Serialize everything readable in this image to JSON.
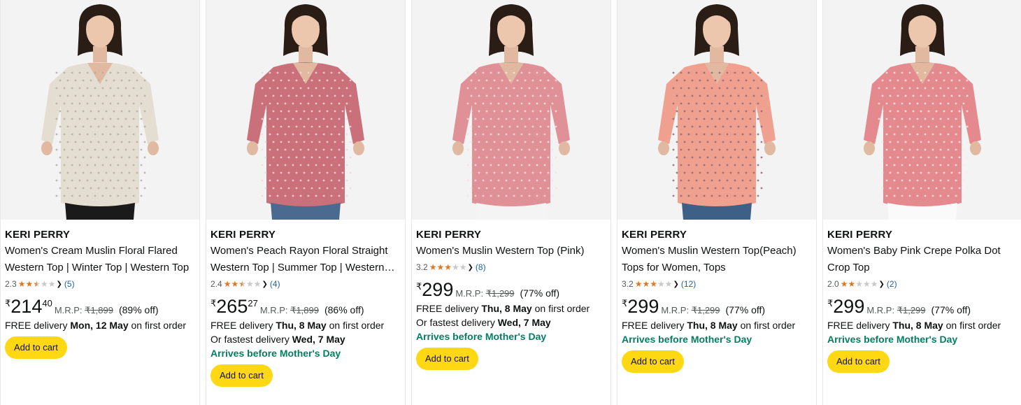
{
  "products": [
    {
      "brand": "KERI PERRY",
      "title": "Women's Cream Muslin Floral Flared Western Top | Winter Top | Western Top",
      "rating": "2.3",
      "stars": [
        1,
        1,
        0.5,
        0,
        0
      ],
      "reviews": "(5)",
      "price_symbol": "₹",
      "price_whole": "214",
      "price_fraction": "40",
      "mrp_label": "M.R.P:",
      "mrp_value": "₹1,899",
      "discount": "(89% off)",
      "delivery_prefix": "FREE delivery ",
      "delivery_date": "Mon, 12 May",
      "delivery_suffix": " on first order",
      "fastest_prefix": "",
      "fastest_date": "",
      "badge": "",
      "cart_label": "Add to cart",
      "garment_color": "#e4ddd2",
      "pattern_color": "#b8ada0",
      "bottom_color": "#1a1a1a"
    },
    {
      "brand": "KERI PERRY",
      "title": "Women's Peach Rayon Floral Straight Western Top | Summer Top | Western Top",
      "rating": "2.4",
      "stars": [
        1,
        1,
        0.5,
        0,
        0
      ],
      "reviews": "(4)",
      "price_symbol": "₹",
      "price_whole": "265",
      "price_fraction": "27",
      "mrp_label": "M.R.P:",
      "mrp_value": "₹1,899",
      "discount": "(86% off)",
      "delivery_prefix": "FREE delivery ",
      "delivery_date": "Thu, 8 May",
      "delivery_suffix": " on first order",
      "fastest_prefix": "Or fastest delivery ",
      "fastest_date": "Wed, 7 May",
      "badge": "Arrives before Mother's Day",
      "cart_label": "Add to cart",
      "garment_color": "#c9707a",
      "pattern_color": "#f2d9dc",
      "bottom_color": "#4a6b8f"
    },
    {
      "brand": "KERI PERRY",
      "title": "Women's Muslin Western Top (Pink)",
      "rating": "3.2",
      "stars": [
        1,
        1,
        1,
        0,
        0
      ],
      "reviews": "(8)",
      "price_symbol": "₹",
      "price_whole": "299",
      "price_fraction": "",
      "mrp_label": "M.R.P:",
      "mrp_value": "₹1,299",
      "discount": "(77% off)",
      "delivery_prefix": "FREE delivery ",
      "delivery_date": "Thu, 8 May",
      "delivery_suffix": " on first order",
      "fastest_prefix": "Or fastest delivery ",
      "fastest_date": "Wed, 7 May",
      "badge": "Arrives before Mother's Day",
      "cart_label": "Add to cart",
      "garment_color": "#e09097",
      "pattern_color": "#fbe3e5",
      "bottom_color": "#f4f4f4"
    },
    {
      "brand": "KERI PERRY",
      "title": "Women's Muslin Western Top(Peach) Tops for Women, Tops",
      "rating": "3.2",
      "stars": [
        1,
        1,
        1,
        0,
        0
      ],
      "reviews": "(12)",
      "price_symbol": "₹",
      "price_whole": "299",
      "price_fraction": "",
      "mrp_label": "M.R.P:",
      "mrp_value": "₹1,299",
      "discount": "(77% off)",
      "delivery_prefix": "FREE delivery ",
      "delivery_date": "Thu, 8 May",
      "delivery_suffix": " on first order",
      "fastest_prefix": "",
      "fastest_date": "",
      "badge": "Arrives before Mother's Day",
      "cart_label": "Add to cart",
      "garment_color": "#f0a08e",
      "pattern_color": "#8a6a7a",
      "bottom_color": "#3e5f86"
    },
    {
      "brand": "KERI PERRY",
      "title": "Women's Baby Pink Crepe Polka Dot Crop Top",
      "rating": "2.0",
      "stars": [
        1,
        1,
        0,
        0,
        0
      ],
      "reviews": "(2)",
      "price_symbol": "₹",
      "price_whole": "299",
      "price_fraction": "",
      "mrp_label": "M.R.P:",
      "mrp_value": "₹1,299",
      "discount": "(77% off)",
      "delivery_prefix": "FREE delivery ",
      "delivery_date": "Thu, 8 May",
      "delivery_suffix": " on first order",
      "fastest_prefix": "",
      "fastest_date": "",
      "badge": "Arrives before Mother's Day",
      "cart_label": "Add to cart",
      "garment_color": "#e48a8f",
      "pattern_color": "#fde8ea",
      "bottom_color": "#fafafa"
    }
  ]
}
